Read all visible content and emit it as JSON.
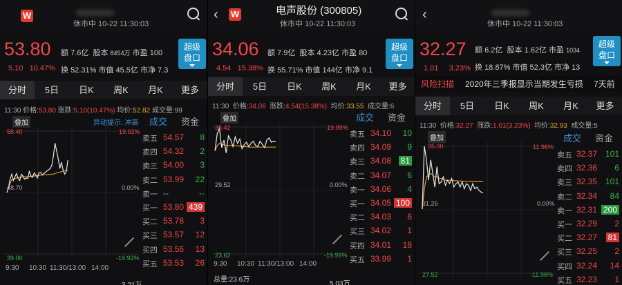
{
  "panels": [
    {
      "title": "",
      "status": "休市中 10-22 11:30:03",
      "price": "53.80",
      "change": "5.10",
      "change_pct": "10.47%",
      "info": [
        [
          "额",
          "7.6亿"
        ],
        [
          "股本",
          "8454万"
        ],
        [
          "市盈",
          "100"
        ],
        [
          "换",
          "52.31%"
        ],
        [
          "市值",
          "45.5亿"
        ],
        [
          "市净",
          "7.3"
        ]
      ],
      "super_button": [
        "超级",
        "盘口"
      ],
      "tabs": [
        "分时",
        "5日",
        "日K",
        "周K",
        "月K",
        "更多"
      ],
      "stats_line": [
        "11:30",
        "价格:",
        "53.80",
        "涨跌:",
        "5.10(10.47%)",
        "均价:",
        "52.82",
        "成交量:",
        "99"
      ],
      "overlay_label": "叠加",
      "hint": "异动提示: 冲高",
      "y_top": "58.40",
      "y_mid": "48.70",
      "y_bot": "39.00",
      "pct_top": "19.92%",
      "pct_mid": "0.00%",
      "pct_bot": "-19.92%",
      "times": [
        "9:30",
        "10:30",
        "11:30/13:00",
        "14:00"
      ],
      "bottom_note": "3.21万",
      "ob_tabs": [
        "成交",
        "资金"
      ],
      "orderbook": [
        {
          "k": "卖五",
          "p": "54.57",
          "v": "8"
        },
        {
          "k": "卖四",
          "p": "54.32",
          "v": "2"
        },
        {
          "k": "卖三",
          "p": "54.00",
          "v": "3"
        },
        {
          "k": "卖二",
          "p": "53.99",
          "v": "22"
        },
        {
          "k": "卖一",
          "p": "--",
          "v": "--"
        },
        {
          "k": "买一",
          "p": "53.80",
          "v": "439"
        },
        {
          "k": "买二",
          "p": "53.78",
          "v": "3"
        },
        {
          "k": "买三",
          "p": "53.57",
          "v": "12"
        },
        {
          "k": "买四",
          "p": "53.56",
          "v": "13"
        },
        {
          "k": "买五",
          "p": "53.53",
          "v": "26"
        }
      ],
      "price_series": [
        48.7,
        49.5,
        50.8,
        51.6,
        50.6,
        51.2,
        51.7,
        50.9,
        50.6,
        51.6,
        51.3,
        50.8,
        51.0,
        50.9,
        52.1,
        51.2,
        51.1,
        51.8,
        51.5,
        51.0,
        51.8,
        51.9,
        51.5,
        51.7,
        51.9,
        52.1,
        52.3,
        52.5,
        53.0,
        54.5,
        56.5,
        55.2,
        54.0,
        52.5,
        53.5,
        52.3,
        51.6,
        52.0,
        53.8
      ],
      "avg_series": [
        48.7,
        49.4,
        50.2,
        50.7,
        50.8,
        50.9,
        51.0,
        51.05,
        51.1,
        51.15,
        51.2,
        51.2,
        51.2,
        51.2,
        51.25,
        51.3,
        51.3,
        51.3,
        51.35,
        51.4,
        51.4,
        51.45,
        51.45,
        51.5,
        51.5,
        51.5,
        51.55,
        51.55,
        51.6,
        51.6,
        51.7,
        51.8,
        51.9,
        51.9,
        52.0,
        52.1,
        52.1,
        52.2,
        52.3
      ]
    },
    {
      "title": "电声股份 (300805)",
      "status": "休市中 10-22 11:30:03",
      "price": "34.06",
      "change": "4.54",
      "change_pct": "15.38%",
      "info": [
        [
          "额",
          "7.9亿"
        ],
        [
          "股本",
          "4.23亿"
        ],
        [
          "市盈",
          "80"
        ],
        [
          "换",
          "55.71%"
        ],
        [
          "市值",
          "144亿"
        ],
        [
          "市净",
          "9.1"
        ]
      ],
      "super_button": [
        "超级",
        "盘口"
      ],
      "tabs": [
        "分时",
        "5日",
        "日K",
        "周K",
        "月K",
        "更多"
      ],
      "stats_line": [
        "11:30",
        "价格:",
        "34.06",
        "涨跌:",
        "4.54(15.38%)",
        "均价:",
        "33.55",
        "成交量:",
        "6"
      ],
      "overlay_label": "叠加",
      "y_top": "35.42",
      "y_mid": "29.52",
      "y_bot": "23.62",
      "pct_top": "19.99%",
      "pct_mid": "0.00%",
      "pct_bot": "-19.99%",
      "times": [
        "9:30",
        "10:30",
        "11:30/13:00",
        "14:00"
      ],
      "bottom_left": "总量:23.6万",
      "bottom_note": "5.03万",
      "ob_tabs": [
        "成交",
        "资金"
      ],
      "orderbook": [
        {
          "k": "卖五",
          "p": "34.10",
          "v": "10"
        },
        {
          "k": "卖四",
          "p": "34.09",
          "v": "9"
        },
        {
          "k": "卖三",
          "p": "34.08",
          "v": "81"
        },
        {
          "k": "卖二",
          "p": "34.07",
          "v": "6"
        },
        {
          "k": "卖一",
          "p": "34.06",
          "v": "4"
        },
        {
          "k": "买一",
          "p": "34.05",
          "v": "100"
        },
        {
          "k": "买二",
          "p": "34.03",
          "v": "6"
        },
        {
          "k": "买三",
          "p": "34.02",
          "v": "1"
        },
        {
          "k": "买四",
          "p": "34.01",
          "v": "18"
        },
        {
          "k": "买五",
          "p": "33.99",
          "v": "1"
        }
      ],
      "price_series": [
        33.2,
        34.8,
        35.3,
        33.5,
        34.2,
        33.0,
        34.6,
        34.2,
        33.6,
        34.5,
        33.9,
        34.3,
        33.4,
        33.8,
        34.0,
        33.6,
        33.9,
        34.1,
        33.7,
        33.6,
        34.1,
        33.8,
        33.5,
        34.2,
        34.4,
        34.0,
        34.1,
        34.06
      ],
      "avg_series": [
        33.2,
        33.7,
        33.9,
        33.8,
        33.8,
        33.7,
        33.7,
        33.7,
        33.65,
        33.7,
        33.65,
        33.65,
        33.6,
        33.6,
        33.6,
        33.55,
        33.55,
        33.55,
        33.55,
        33.55,
        33.55,
        33.55,
        33.55,
        33.55,
        33.55,
        33.55,
        33.55,
        33.55
      ]
    },
    {
      "title": "",
      "status": "休市中 10-22 11:30:03",
      "price": "32.27",
      "change": "1.01",
      "change_pct": "3.23%",
      "info": [
        [
          "额",
          "6.2亿"
        ],
        [
          "股本",
          "1.62亿"
        ],
        [
          "市盈",
          "1034"
        ],
        [
          "换",
          "18.87%"
        ],
        [
          "市值",
          "52.3亿"
        ],
        [
          "市净",
          "13"
        ]
      ],
      "super_button": [
        "超级",
        "盘口"
      ],
      "risk_label": "风险扫描",
      "risk_text": "2020年三季报显示当期发生亏损",
      "risk_time": "7天前",
      "tabs": [
        "分时",
        "5日",
        "日K",
        "周K",
        "月K",
        "更多"
      ],
      "stats_line": [
        "11:30",
        "价格:",
        "32.27",
        "涨跌:",
        "1.01(3.23%)",
        "均价:",
        "32.93",
        "成交量:",
        "5"
      ],
      "overlay_label": "叠加",
      "y_top": "35.00",
      "y_mid": "31.26",
      "y_bot": "27.52",
      "pct_top": "11.96%",
      "pct_mid": "0.00%",
      "pct_bot": "-11.96%",
      "times": [
        "9:30",
        "10:30",
        "11:30/13:00",
        "14:00"
      ],
      "ob_tabs": [
        "成交",
        "资金"
      ],
      "orderbook": [
        {
          "k": "卖五",
          "p": "32.37",
          "v": "101"
        },
        {
          "k": "卖四",
          "p": "32.36",
          "v": "6"
        },
        {
          "k": "卖三",
          "p": "32.35",
          "v": "101"
        },
        {
          "k": "卖二",
          "p": "32.34",
          "v": "84"
        },
        {
          "k": "卖一",
          "p": "32.31",
          "v": "200"
        },
        {
          "k": "买一",
          "p": "32.29",
          "v": "2"
        },
        {
          "k": "买二",
          "p": "32.27",
          "v": "81"
        },
        {
          "k": "买三",
          "p": "32.25",
          "v": "2"
        },
        {
          "k": "买四",
          "p": "32.24",
          "v": "14"
        },
        {
          "k": "买五",
          "p": "32.23",
          "v": "1"
        }
      ],
      "price_series": [
        31.3,
        35.0,
        34.2,
        33.0,
        34.2,
        33.4,
        32.6,
        33.8,
        32.8,
        32.9,
        33.2,
        32.7,
        33.0,
        32.8,
        33.1,
        32.6,
        32.8,
        32.9,
        32.6,
        32.9,
        32.5,
        32.8,
        32.7,
        32.4,
        32.8,
        32.5,
        32.6,
        32.4,
        32.3,
        32.27
      ],
      "avg_series": [
        31.3,
        32.5,
        33.2,
        33.3,
        33.4,
        33.3,
        33.2,
        33.2,
        33.1,
        33.1,
        33.05,
        33.0,
        33.0,
        33.0,
        33.0,
        32.98,
        32.97,
        32.96,
        32.95,
        32.95,
        32.94,
        32.94,
        32.94,
        32.93,
        32.93,
        32.93,
        32.93,
        32.93,
        32.93,
        32.93
      ]
    }
  ]
}
